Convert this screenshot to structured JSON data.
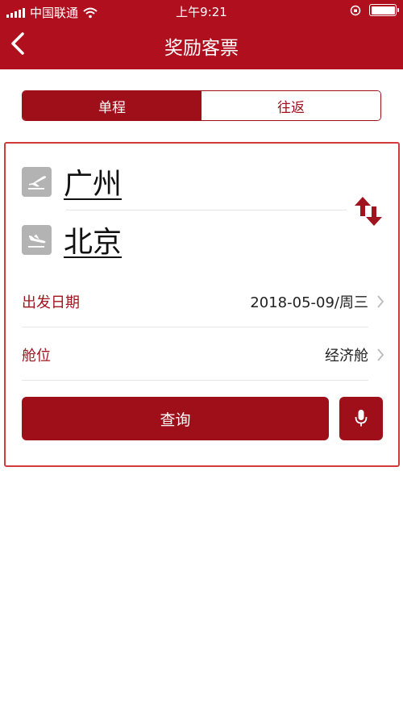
{
  "status_bar": {
    "carrier": "中国联通",
    "time": "上午9:21"
  },
  "header": {
    "title": "奖励客票",
    "back_icon": "chevron-left-icon"
  },
  "trip_type": {
    "one_way": "单程",
    "round_trip": "往返",
    "selected": "单程"
  },
  "route": {
    "origin": "广州",
    "origin_icon": "plane-takeoff-icon",
    "destination": "北京",
    "destination_icon": "plane-landing-icon",
    "swap_icon": "swap-arrows-icon"
  },
  "departure": {
    "label": "出发日期",
    "value": "2018-05-09/周三"
  },
  "cabin": {
    "label": "舱位",
    "value": "经济舱"
  },
  "actions": {
    "search_label": "查询",
    "voice_icon": "microphone-icon"
  },
  "colors": {
    "brand_red": "#b0101e",
    "button_red": "#9e0f19",
    "label_red": "#a0141f",
    "card_border": "#d23b3b"
  }
}
